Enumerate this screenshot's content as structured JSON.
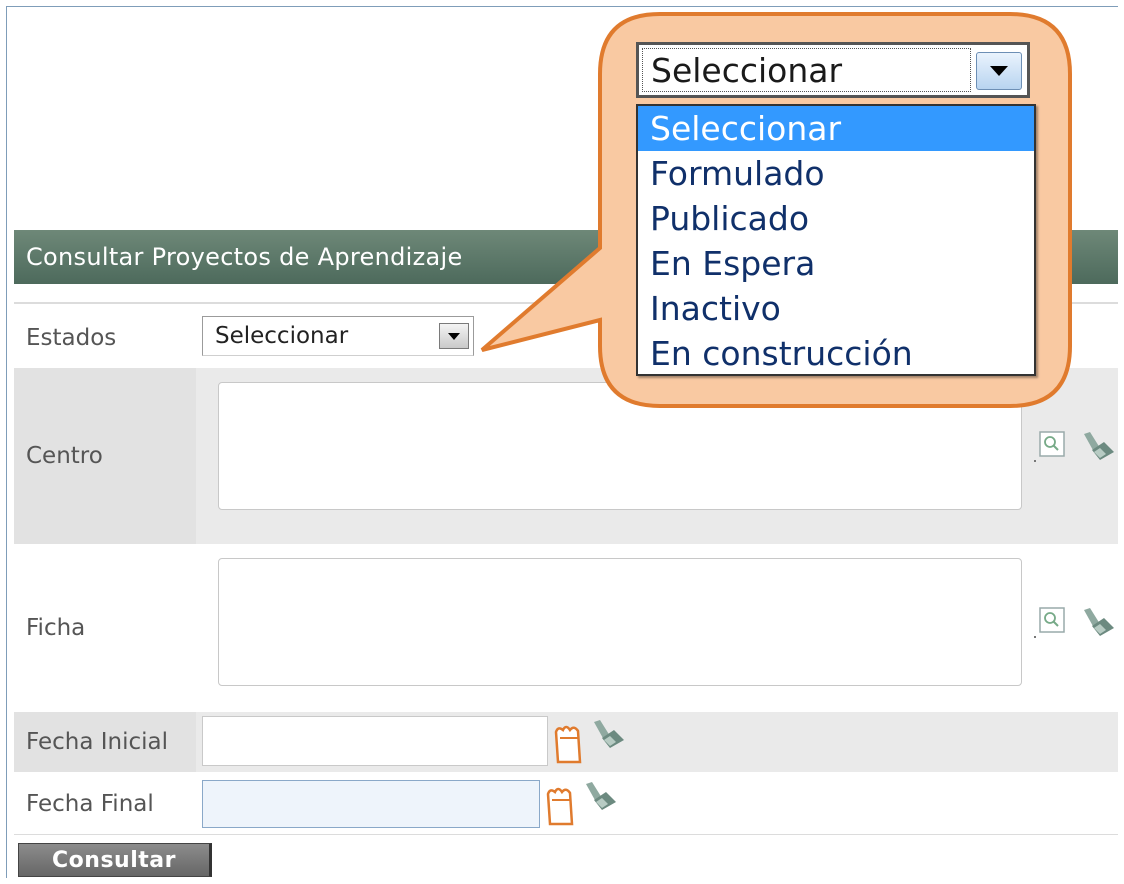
{
  "header": {
    "title": "Consultar Proyectos de Aprendizaje"
  },
  "form": {
    "estados": {
      "label": "Estados",
      "value": "Seleccionar"
    },
    "centro": {
      "label": "Centro"
    },
    "ficha": {
      "label": "Ficha"
    },
    "fecha_inicial": {
      "label": "Fecha Inicial",
      "value": ""
    },
    "fecha_final": {
      "label": "Fecha Final",
      "value": ""
    },
    "submit_label": "Consultar"
  },
  "callout": {
    "select_value": "Seleccionar",
    "options": [
      "Seleccionar",
      "Formulado",
      "Publicado",
      "En Espera",
      "Inactivo",
      "En construcción"
    ],
    "selected_index": 0
  },
  "icons": {
    "search": "search-icon",
    "clear": "eraser-icon",
    "calendar": "calendar-icon"
  },
  "colors": {
    "header_bg": "#5b7868",
    "callout_fill": "#f9c9a2",
    "callout_border": "#e07b2e",
    "highlight": "#3399ff"
  }
}
